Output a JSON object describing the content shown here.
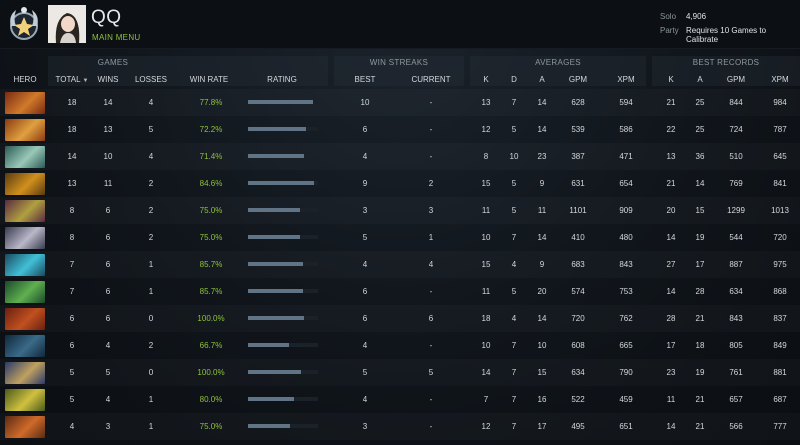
{
  "header": {
    "username": "QQ",
    "main_menu": "MAIN MENU",
    "solo_label": "Solo",
    "solo_value": "4,906",
    "party_label": "Party",
    "party_value": "Requires 10 Games to Calibrate"
  },
  "groups": {
    "games": "GAMES",
    "win_streaks": "WIN STREAKS",
    "averages": "AVERAGES",
    "best_records": "BEST RECORDS"
  },
  "columns": {
    "hero": "HERO",
    "total": "TOTAL",
    "total_sort_icon": "chevron-down-icon",
    "wins": "WINS",
    "losses": "LOSSES",
    "win_rate": "WIN RATE",
    "rating": "RATING",
    "best": "BEST",
    "current": "CURRENT",
    "avg_k": "K",
    "avg_d": "D",
    "avg_a": "A",
    "avg_gpm": "GPM",
    "avg_xpm": "XPM",
    "best_k": "K",
    "best_a": "A",
    "best_gpm": "GPM",
    "best_xpm": "XPM"
  },
  "colors": {
    "accent_green": "#8fc23a",
    "rating_bar": "#617485"
  },
  "rows": [
    {
      "hero_colors": [
        "#7a2a12",
        "#d07a2a"
      ],
      "total": "18",
      "wins": "14",
      "losses": "4",
      "win_rate": "77.8%",
      "rating": 0.93,
      "best": "10",
      "current": "-",
      "k": "13",
      "d": "7",
      "a": "14",
      "gpm": "628",
      "xpm": "594",
      "bk": "21",
      "ba": "25",
      "bgpm": "844",
      "bxpm": "984"
    },
    {
      "hero_colors": [
        "#8a3a10",
        "#e0a040"
      ],
      "total": "18",
      "wins": "13",
      "losses": "5",
      "win_rate": "72.2%",
      "rating": 0.83,
      "best": "6",
      "current": "-",
      "k": "12",
      "d": "5",
      "a": "14",
      "gpm": "539",
      "xpm": "586",
      "bk": "22",
      "ba": "25",
      "bgpm": "724",
      "bxpm": "787"
    },
    {
      "hero_colors": [
        "#2a5a55",
        "#9ac8b8"
      ],
      "total": "14",
      "wins": "10",
      "losses": "4",
      "win_rate": "71.4%",
      "rating": 0.8,
      "best": "4",
      "current": "-",
      "k": "8",
      "d": "10",
      "a": "23",
      "gpm": "387",
      "xpm": "471",
      "bk": "13",
      "ba": "36",
      "bgpm": "510",
      "bxpm": "645"
    },
    {
      "hero_colors": [
        "#5a3a12",
        "#d0901c"
      ],
      "total": "13",
      "wins": "11",
      "losses": "2",
      "win_rate": "84.6%",
      "rating": 0.94,
      "best": "9",
      "current": "2",
      "k": "15",
      "d": "5",
      "a": "9",
      "gpm": "631",
      "xpm": "654",
      "bk": "21",
      "ba": "14",
      "bgpm": "769",
      "bxpm": "841"
    },
    {
      "hero_colors": [
        "#5a2a40",
        "#b0a040"
      ],
      "total": "8",
      "wins": "6",
      "losses": "2",
      "win_rate": "75.0%",
      "rating": 0.74,
      "best": "3",
      "current": "3",
      "k": "11",
      "d": "5",
      "a": "11",
      "gpm": "1101",
      "xpm": "909",
      "bk": "20",
      "ba": "15",
      "bgpm": "1299",
      "bxpm": "1013"
    },
    {
      "hero_colors": [
        "#3a3a50",
        "#b8b8c8"
      ],
      "total": "8",
      "wins": "6",
      "losses": "2",
      "win_rate": "75.0%",
      "rating": 0.74,
      "best": "5",
      "current": "1",
      "k": "10",
      "d": "7",
      "a": "14",
      "gpm": "410",
      "xpm": "480",
      "bk": "14",
      "ba": "19",
      "bgpm": "544",
      "bxpm": "720"
    },
    {
      "hero_colors": [
        "#1a4a60",
        "#40c0d8"
      ],
      "total": "7",
      "wins": "6",
      "losses": "1",
      "win_rate": "85.7%",
      "rating": 0.78,
      "best": "4",
      "current": "4",
      "k": "15",
      "d": "4",
      "a": "9",
      "gpm": "683",
      "xpm": "843",
      "bk": "27",
      "ba": "17",
      "bgpm": "887",
      "bxpm": "975"
    },
    {
      "hero_colors": [
        "#1a4a2a",
        "#60b050"
      ],
      "total": "7",
      "wins": "6",
      "losses": "1",
      "win_rate": "85.7%",
      "rating": 0.78,
      "best": "6",
      "current": "-",
      "k": "11",
      "d": "5",
      "a": "20",
      "gpm": "574",
      "xpm": "753",
      "bk": "14",
      "ba": "28",
      "bgpm": "634",
      "bxpm": "868"
    },
    {
      "hero_colors": [
        "#6a2010",
        "#c05020"
      ],
      "total": "6",
      "wins": "6",
      "losses": "0",
      "win_rate": "100.0%",
      "rating": 0.8,
      "best": "6",
      "current": "6",
      "k": "18",
      "d": "4",
      "a": "14",
      "gpm": "720",
      "xpm": "762",
      "bk": "28",
      "ba": "21",
      "bgpm": "843",
      "bxpm": "837"
    },
    {
      "hero_colors": [
        "#10283a",
        "#3a6a8a"
      ],
      "total": "6",
      "wins": "4",
      "losses": "2",
      "win_rate": "66.7%",
      "rating": 0.58,
      "best": "4",
      "current": "-",
      "k": "10",
      "d": "7",
      "a": "10",
      "gpm": "608",
      "xpm": "665",
      "bk": "17",
      "ba": "18",
      "bgpm": "805",
      "bxpm": "849"
    },
    {
      "hero_colors": [
        "#2a3a6a",
        "#c0a060"
      ],
      "total": "5",
      "wins": "5",
      "losses": "0",
      "win_rate": "100.0%",
      "rating": 0.76,
      "best": "5",
      "current": "5",
      "k": "14",
      "d": "7",
      "a": "15",
      "gpm": "634",
      "xpm": "790",
      "bk": "23",
      "ba": "19",
      "bgpm": "761",
      "bxpm": "881"
    },
    {
      "hero_colors": [
        "#4a5a1a",
        "#d0c040"
      ],
      "total": "5",
      "wins": "4",
      "losses": "1",
      "win_rate": "80.0%",
      "rating": 0.66,
      "best": "4",
      "current": "-",
      "k": "7",
      "d": "7",
      "a": "16",
      "gpm": "522",
      "xpm": "459",
      "bk": "11",
      "ba": "21",
      "bgpm": "657",
      "bxpm": "687"
    },
    {
      "hero_colors": [
        "#5a2a12",
        "#d06a2a"
      ],
      "total": "4",
      "wins": "3",
      "losses": "1",
      "win_rate": "75.0%",
      "rating": 0.6,
      "best": "3",
      "current": "-",
      "k": "12",
      "d": "7",
      "a": "17",
      "gpm": "495",
      "xpm": "651",
      "bk": "14",
      "ba": "21",
      "bgpm": "566",
      "bxpm": "777"
    }
  ]
}
